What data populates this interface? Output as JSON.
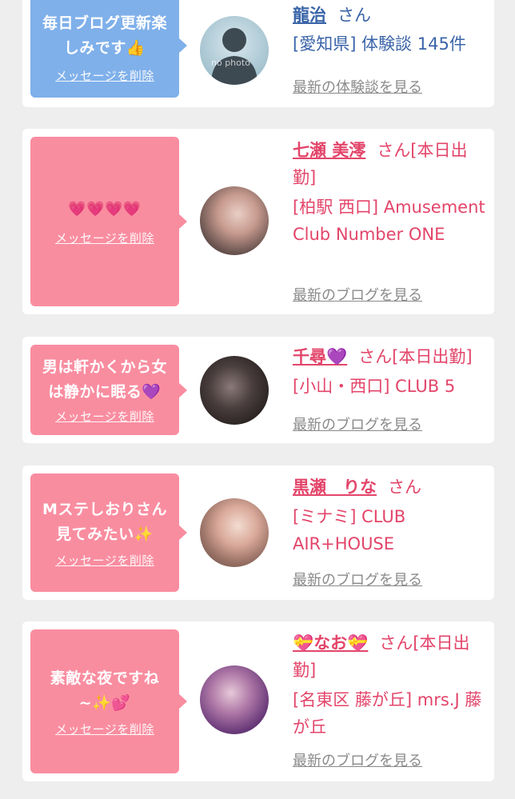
{
  "items": [
    {
      "message": "毎日ブログ更新楽しみです👍",
      "delete_label": "メッセージを削除",
      "name": "龍治",
      "honorific": "さん",
      "location": "[愛知県] 体験談 145件",
      "more_label": "最新の体験談を見る",
      "avatar_text": "no photo"
    },
    {
      "message": "💗💗💗💗",
      "delete_label": "メッセージを削除",
      "name": "七瀬 美澪",
      "honorific": "さん[本日出勤]",
      "location": "[柏駅 西口] Amusement Club Number ONE",
      "more_label": "最新のブログを見る"
    },
    {
      "message": "男は軒かくから女は静かに眠る💜",
      "delete_label": "メッセージを削除",
      "name": "千尋💜",
      "honorific": "さん[本日出勤]",
      "location": "[小山・西口] CLUB 5",
      "more_label": "最新のブログを見る"
    },
    {
      "message": "Mステしおりさん見てみたい✨",
      "delete_label": "メッセージを削除",
      "name": "黒瀬　りな",
      "honorific": "さん",
      "location": "[ミナミ] CLUB AIR+HOUSE",
      "more_label": "最新のブログを見る"
    },
    {
      "message": "素敵な夜ですね~✨💕",
      "delete_label": "メッセージを削除",
      "name": "💝なお💝",
      "honorific": "さん[本日出勤]",
      "location": "[名東区 藤が丘] mrs.J 藤が丘",
      "more_label": "最新のブログを見る"
    }
  ],
  "colors": {
    "blue_bubble": "#7fb0ea",
    "pink_bubble": "#f98da0",
    "member_name": "#3a64a8",
    "cast_name": "#e3456a",
    "link_gray": "#8a8a8a"
  }
}
